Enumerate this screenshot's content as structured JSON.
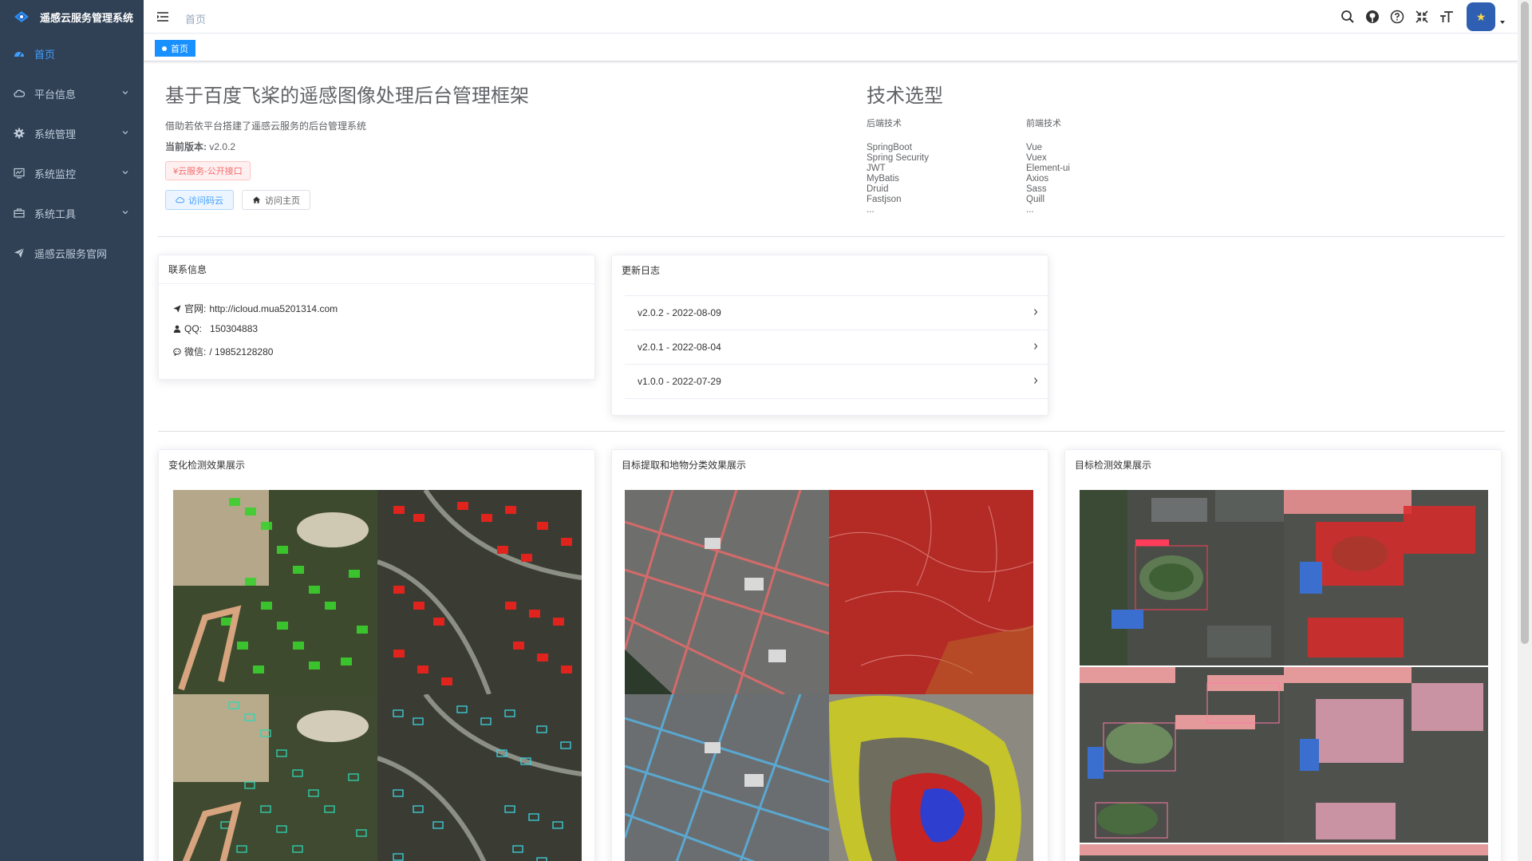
{
  "app": {
    "title": "遥感云服务管理系统"
  },
  "sidebar": {
    "items": [
      {
        "label": "首页",
        "icon": "dashboard-icon"
      },
      {
        "label": "平台信息",
        "icon": "cloud-icon"
      },
      {
        "label": "系统管理",
        "icon": "gear-icon"
      },
      {
        "label": "系统监控",
        "icon": "monitor-icon"
      },
      {
        "label": "系统工具",
        "icon": "toolbox-icon"
      },
      {
        "label": "遥感云服务官网",
        "icon": "send-icon"
      }
    ]
  },
  "navbar": {
    "breadcrumb": "首页",
    "icons": [
      "search-icon",
      "github-icon",
      "question-icon",
      "fullscreen-exit-icon",
      "font-size-icon"
    ]
  },
  "tags": {
    "active": "首页"
  },
  "intro": {
    "title": "基于百度飞桨的遥感图像处理后台管理框架",
    "desc": "借助若依平台搭建了遥感云服务的后台管理系统",
    "version_label": "当前版本:",
    "version_value": " v2.0.2",
    "price_tag": "¥云服务-公开接口",
    "btn_gitee": "访问码云",
    "btn_home": "访问主页"
  },
  "tech": {
    "title": "技术选型",
    "backend_title": "后端技术",
    "backend": [
      "SpringBoot",
      "Spring Security",
      "JWT",
      "MyBatis",
      "Druid",
      "Fastjson",
      "..."
    ],
    "frontend_title": "前端技术",
    "frontend": [
      "Vue",
      "Vuex",
      "Element-ui",
      "Axios",
      "Sass",
      "Quill",
      "..."
    ]
  },
  "contact": {
    "title": "联系信息",
    "site_label": "官网:",
    "site_value": "http://icloud.mua5201314.com",
    "qq_label": "QQ:",
    "qq_value": "150304883",
    "wechat_label": "微信:",
    "wechat_value": "/ 19852128280"
  },
  "changelog": {
    "title": "更新日志",
    "items": [
      "v2.0.2 - 2022-08-09",
      "v2.0.1 - 2022-08-04",
      "v1.0.0 - 2022-07-29"
    ]
  },
  "showcase": {
    "change_detection": "变化检测效果展示",
    "segmentation": "目标提取和地物分类效果展示",
    "detection": "目标检测效果展示"
  },
  "colors": {
    "sidebar_bg": "#304156",
    "accent": "#409eff",
    "menu_text": "#bfcbd9"
  }
}
